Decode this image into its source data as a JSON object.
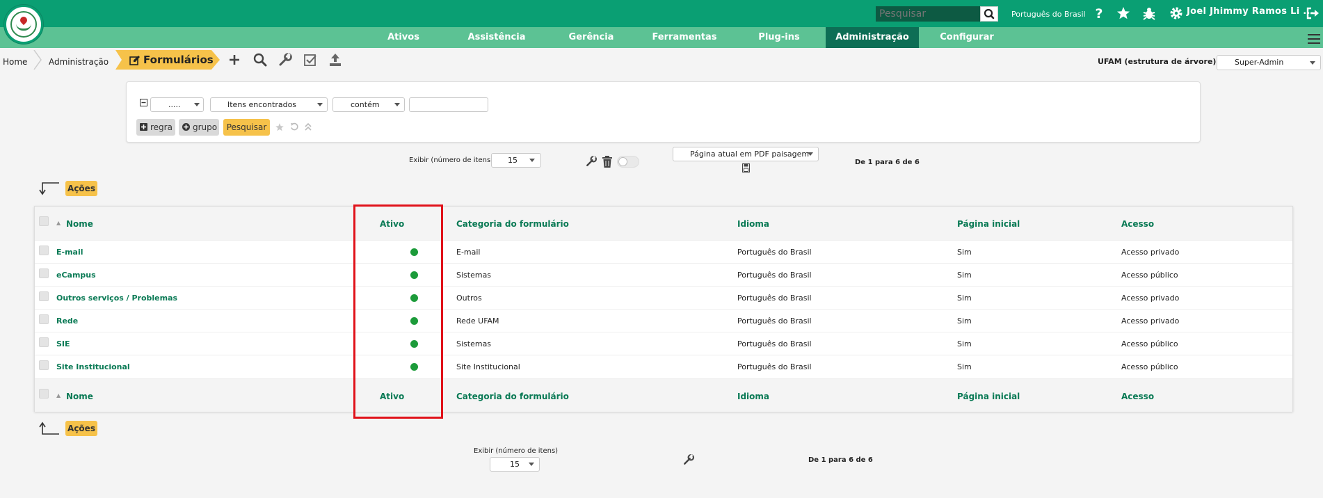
{
  "header": {
    "search_placeholder": "Pesquisar",
    "language": "Português do Brasil",
    "user_name": "Joel Jhimmy Ramos Li ..."
  },
  "menu": {
    "items": [
      "Ativos",
      "Assistência",
      "Gerência",
      "Ferramentas",
      "Plug-ins",
      "Administração",
      "Configurar"
    ],
    "active": "Administração"
  },
  "breadcrumb": {
    "home": "Home",
    "section": "Administração",
    "current": "Formulários"
  },
  "entity": {
    "label": "UFAM (estrutura de árvore)",
    "profile": "Super-Admin"
  },
  "search": {
    "field": ".....",
    "criteria": "Itens encontrados",
    "operator": "contém",
    "value": "",
    "rule_label": "regra",
    "group_label": "grupo",
    "submit_label": "Pesquisar"
  },
  "pager_top": {
    "show_label": "Exibir (número de itens)",
    "per_page": "15",
    "export": "Página atual em PDF paisagem",
    "count": "De 1 para 6 de 6"
  },
  "pager_bottom": {
    "show_label": "Exibir (número de itens)",
    "per_page": "15",
    "count": "De 1 para 6 de 6"
  },
  "actions_label": "Ações",
  "table": {
    "columns": [
      "Nome",
      "Ativo",
      "Categoria do formulário",
      "Idioma",
      "Página inicial",
      "Acesso"
    ],
    "rows": [
      {
        "name": "E-mail",
        "active": true,
        "category": "E-mail",
        "language": "Português do Brasil",
        "homepage": "Sim",
        "access": "Acesso privado"
      },
      {
        "name": "eCampus",
        "active": true,
        "category": "Sistemas",
        "language": "Português do Brasil",
        "homepage": "Sim",
        "access": "Acesso público"
      },
      {
        "name": "Outros serviços / Problemas",
        "active": true,
        "category": "Outros",
        "language": "Português do Brasil",
        "homepage": "Sim",
        "access": "Acesso privado"
      },
      {
        "name": "Rede",
        "active": true,
        "category": "Rede UFAM",
        "language": "Português do Brasil",
        "homepage": "Sim",
        "access": "Acesso privado"
      },
      {
        "name": "SIE",
        "active": true,
        "category": "Sistemas",
        "language": "Português do Brasil",
        "homepage": "Sim",
        "access": "Acesso público"
      },
      {
        "name": "Site Institucional",
        "active": true,
        "category": "Site Institucional",
        "language": "Português do Brasil",
        "homepage": "Sim",
        "access": "Acesso público"
      }
    ]
  },
  "colors": {
    "brand": "#0a9f73",
    "menu": "#5cc294",
    "active_menu": "#0d6e55",
    "accent_yellow": "#f6c24a",
    "active_dot": "#1c9b3a",
    "highlight": "#e0121a"
  }
}
